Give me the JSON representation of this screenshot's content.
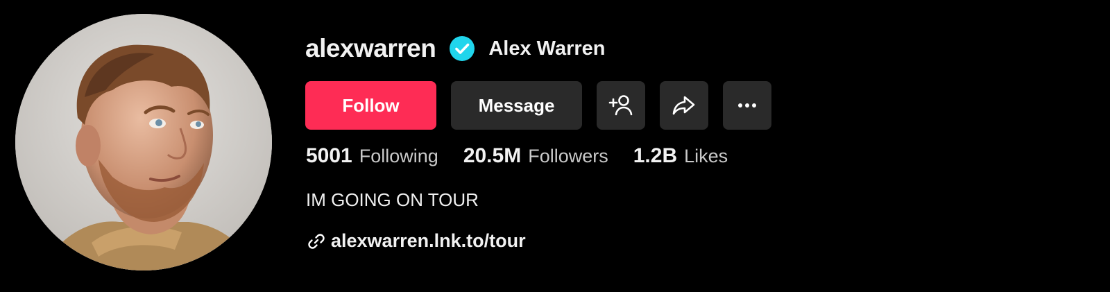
{
  "profile": {
    "username": "alexwarren",
    "display_name": "Alex Warren",
    "verified": true,
    "verified_color": "#20d5ec",
    "avatar_description": "profile photo"
  },
  "actions": {
    "follow_label": "Follow",
    "follow_color": "#fe2c55",
    "message_label": "Message",
    "icons": [
      "add-friend-icon",
      "share-icon",
      "more-icon"
    ]
  },
  "stats": [
    {
      "value": "5001",
      "label": "Following"
    },
    {
      "value": "20.5M",
      "label": "Followers"
    },
    {
      "value": "1.2B",
      "label": "Likes"
    }
  ],
  "bio": "IM GOING ON TOUR",
  "link": {
    "text": "alexwarren.lnk.to/tour",
    "icon": "link-icon"
  }
}
